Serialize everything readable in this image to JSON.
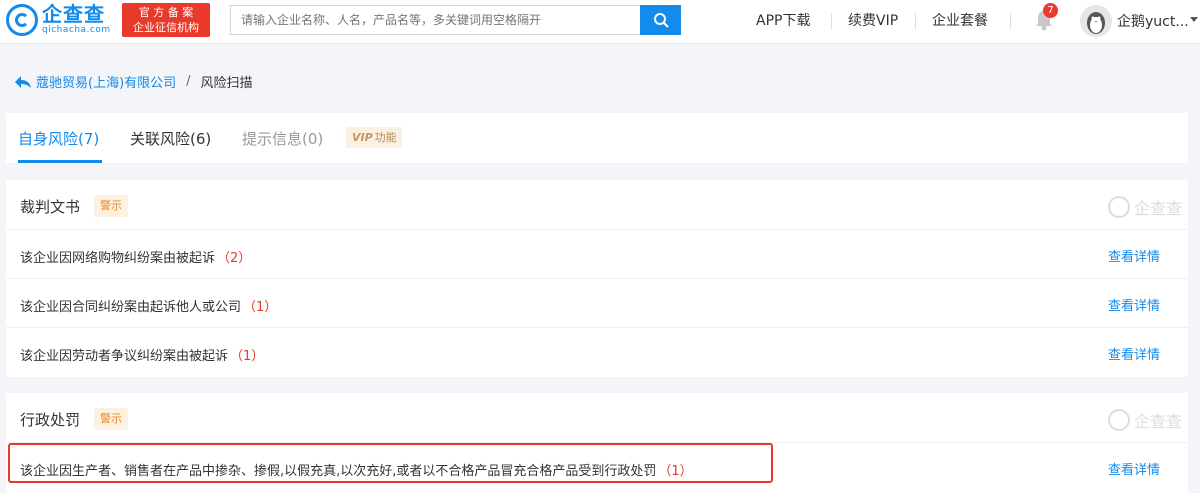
{
  "header": {
    "logo_name": "企查查",
    "logo_domain": "qichacha.com",
    "official_badge_line1": "官 方 备 案",
    "official_badge_line2": "企业征信机构",
    "search_placeholder": "请输入企业名称、人名，产品名等，多关键词用空格隔开",
    "nav": [
      "APP下载",
      "续费VIP",
      "企业套餐"
    ],
    "notification_count": "7",
    "user_name": "企鹅yuct..."
  },
  "breadcrumb": {
    "company": "蔻驰贸易(上海)有限公司",
    "separator": "/",
    "current": "风险扫描"
  },
  "tabs": [
    {
      "label": "自身风险(7)"
    },
    {
      "label": "关联风险(6)"
    },
    {
      "label": "提示信息(0)"
    }
  ],
  "vip": {
    "mark": "VIP",
    "label": "功能"
  },
  "watermark_text": "企查查",
  "sections": [
    {
      "title": "裁判文书",
      "tag": "警示",
      "rows": [
        {
          "text": "该企业因网络购物纠纷案由被起诉",
          "count": "（2）",
          "link": "查看详情"
        },
        {
          "text": "该企业因合同纠纷案由起诉他人或公司",
          "count": "（1）",
          "link": "查看详情"
        },
        {
          "text": "该企业因劳动者争议纠纷案由被起诉",
          "count": "（1）",
          "link": "查看详情"
        }
      ]
    },
    {
      "title": "行政处罚",
      "tag": "警示",
      "rows": [
        {
          "text": "该企业因生产者、销售者在产品中掺杂、掺假,以假充真,以次充好,或者以不合格产品冒充合格产品受到行政处罚",
          "count": "（1）",
          "link": "查看详情"
        }
      ]
    }
  ],
  "colors": {
    "brand": "#128bed",
    "alert": "#e8392a",
    "warn": "#e88a22"
  }
}
